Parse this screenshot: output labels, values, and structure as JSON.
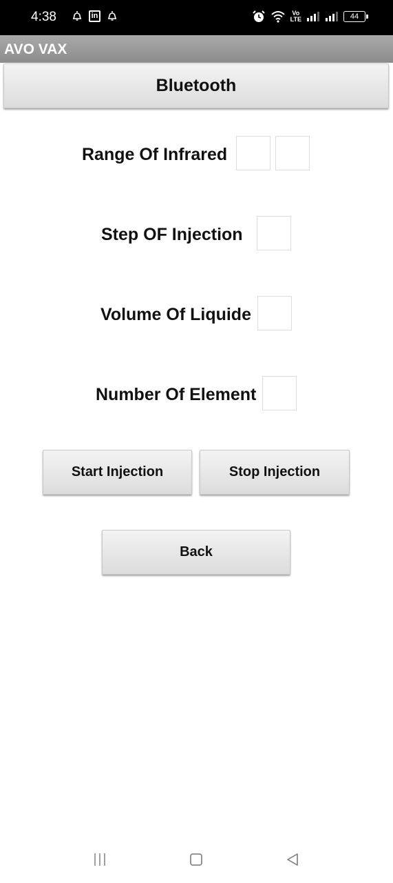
{
  "status_bar": {
    "time": "4:38",
    "linkedin_glyph": "in",
    "volte_top": "Vo",
    "volte_bottom": "LTE",
    "battery": "44",
    "icons": [
      "notification-bell-icon",
      "linkedin-icon",
      "notification-bell-icon",
      "alarm-icon",
      "wifi-icon",
      "volte-icon",
      "signal-icon",
      "signal-icon",
      "battery-icon"
    ]
  },
  "title_bar": {
    "title": "AVO VAX"
  },
  "main": {
    "bluetooth_button": "Bluetooth",
    "range_label": "Range Of Infrared",
    "step_label": "Step OF Injection",
    "volume_label": "Volume Of Liquide",
    "number_label": "Number Of Element",
    "start_button": "Start Injection",
    "stop_button": "Stop Injection",
    "back_button": "Back"
  },
  "nav_bar": {
    "icons": [
      "menu-icon",
      "home-icon",
      "back-icon"
    ]
  }
}
